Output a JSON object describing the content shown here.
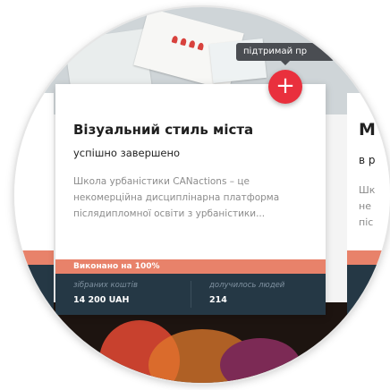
{
  "card": {
    "title": "Візуальний стиль міста",
    "subtitle": "успішно завершено",
    "description": "Школа урбаністики CANactions – це некомерційна дисциплінарна платформа післядипломної освіти з урбаністики...",
    "progress_label": "Виконано на 100%",
    "progress_value": 100,
    "stats": [
      {
        "label": "зібраних коштів",
        "value": "14 200 UAH"
      },
      {
        "label": "долучилось людей",
        "value": "214"
      }
    ]
  },
  "tooltip": {
    "text": "підтримай пр"
  },
  "plus_button": {
    "label": "+"
  },
  "next_card": {
    "title": "М",
    "subtitle": "в р",
    "desc": "Шк\nне\nпіс"
  },
  "colors": {
    "accent": "#e9303d",
    "progress": "#e8826a",
    "stats_bg": "#253845",
    "tooltip_bg": "#4a4d52"
  }
}
